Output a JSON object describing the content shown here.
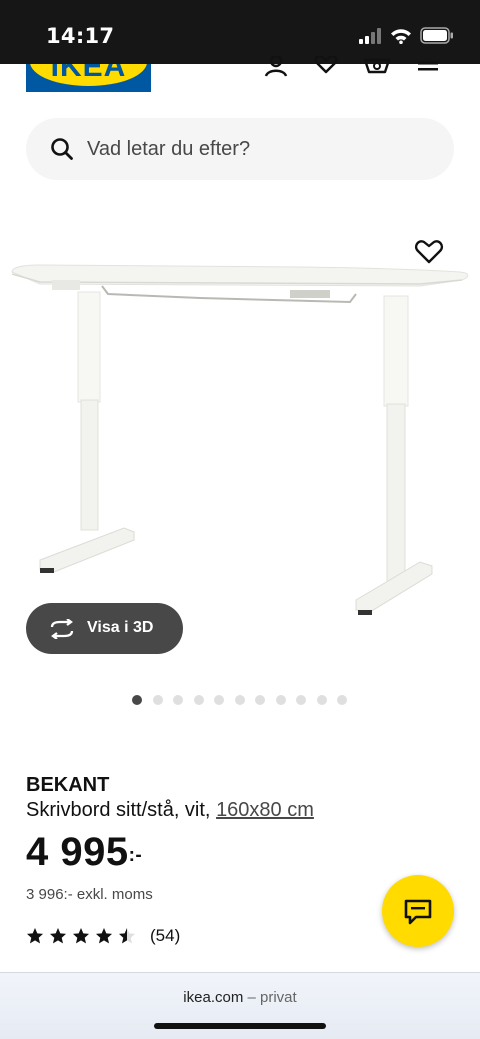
{
  "status_bar": {
    "time": "14:17",
    "icons": [
      "signal-icon",
      "wifi-icon",
      "battery-icon"
    ]
  },
  "header": {
    "logo_text": "IKEA",
    "icons": [
      "profile-icon",
      "wishlist-heart-icon",
      "shopping-basket-icon",
      "menu-icon"
    ]
  },
  "search": {
    "placeholder": "Vad letar du efter?",
    "icon": "search-icon"
  },
  "gallery": {
    "view_3d_label": "Visa i 3D",
    "dot_count": 11,
    "active_index": 0
  },
  "product": {
    "name": "BEKANT",
    "description": "Skrivbord sitt/stå, vit,",
    "measurement": "160x80 cm",
    "price_main": "4 995",
    "price_suffix": ":-",
    "price_excl": "3 996:- exkl. moms",
    "rating_value": 4.5,
    "rating_max": 5,
    "review_count": "(54)"
  },
  "colors": {
    "ikea_blue": "#0058a3",
    "ikea_yellow": "#ffdb00",
    "dark_gray": "#484848"
  },
  "browser": {
    "domain": "ikea.com",
    "separator": " – ",
    "mode": "privat"
  }
}
